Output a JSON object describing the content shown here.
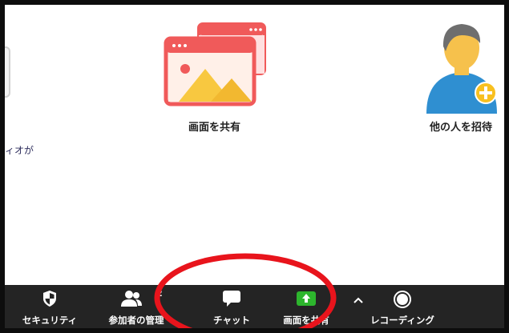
{
  "tiles": {
    "share_screen_label": "画面を共有",
    "invite_label": "他の人を招待"
  },
  "side_text": "ィオが",
  "toolbar": {
    "security_label": "セキュリティ",
    "participants_label": "参加者の管理",
    "participants_count": "2",
    "chat_label": "チャット",
    "share_label": "画面を共有",
    "record_label": "レコーディング"
  },
  "icons": {
    "security": "shield-icon",
    "participants": "people-icon",
    "chat": "chat-bubble-icon",
    "share": "share-arrow-icon",
    "more": "caret-up-icon",
    "record": "record-icon"
  },
  "colors": {
    "share_tile": "#f05a5a",
    "share_green": "#2db52d",
    "annotation": "#e8141c",
    "toolbar_bg": "#242424",
    "avatar_blue": "#2f8fd1"
  }
}
